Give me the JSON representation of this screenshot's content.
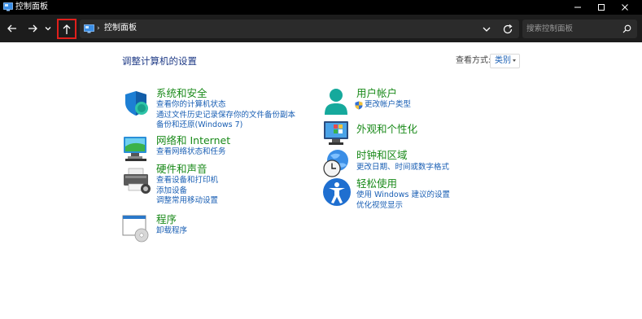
{
  "window": {
    "title": "控制面板"
  },
  "address_bar": {
    "separator": "›",
    "breadcrumb": "控制面板"
  },
  "search": {
    "placeholder": "搜索控制面板"
  },
  "main": {
    "title": "调整计算机的设置",
    "view_by_label": "查看方式:",
    "view_by_value": "类别"
  },
  "left_categories": [
    {
      "title": "系统和安全",
      "links": [
        "查看你的计算机状态",
        "通过文件历史记录保存你的文件备份副本",
        "备份和还原(Windows 7)"
      ]
    },
    {
      "title": "网络和 Internet",
      "links": [
        "查看网络状态和任务"
      ]
    },
    {
      "title": "硬件和声音",
      "links": [
        "查看设备和打印机",
        "添加设备",
        "调整常用移动设置"
      ]
    },
    {
      "title": "程序",
      "links": [
        "卸载程序"
      ]
    }
  ],
  "right_categories": [
    {
      "title": "用户帐户",
      "links": [
        "更改帐户类型"
      ]
    },
    {
      "title": "外观和个性化",
      "links": []
    },
    {
      "title": "时钟和区域",
      "links": [
        "更改日期、时间或数字格式"
      ]
    },
    {
      "title": "轻松使用",
      "links": [
        "使用 Windows 建议的设置",
        "优化视觉显示"
      ]
    }
  ],
  "colors": {
    "category_title": "#1a8a1a",
    "link": "#1a5fb4",
    "page_title": "#1e3a86",
    "highlight_border": "#e0201c",
    "titlebar_bg": "#000000",
    "navbar_bg": "#1c1c1c"
  },
  "icons": {
    "system_security": "shield-icon",
    "network": "network-globe-icon",
    "hardware": "printer-icon",
    "programs": "programs-disc-icon",
    "user_accounts": "user-icon",
    "appearance": "monitor-palette-icon",
    "clock_region": "clock-globe-icon",
    "ease_of_access": "accessibility-icon"
  }
}
